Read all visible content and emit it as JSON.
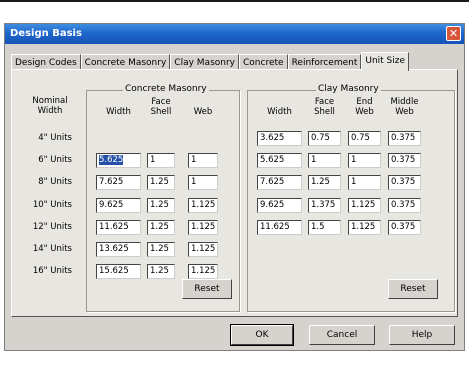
{
  "window": {
    "title": "Design Basis"
  },
  "tabs": [
    {
      "label": "Design Codes",
      "active": false
    },
    {
      "label": "Concrete Masonry",
      "active": false
    },
    {
      "label": "Clay Masonry",
      "active": false
    },
    {
      "label": "Concrete",
      "active": false
    },
    {
      "label": "Reinforcement",
      "active": false
    },
    {
      "label": "Unit Size",
      "active": true
    }
  ],
  "row_header": "Nominal\nWidth",
  "rows": [
    "4\" Units",
    "6\" Units",
    "8\" Units",
    "10\" Units",
    "12\" Units",
    "14\" Units",
    "16\" Units"
  ],
  "concrete": {
    "title": "Concrete Masonry",
    "headers": [
      "Width",
      "Face\nShell",
      "Web"
    ],
    "values": [
      null,
      [
        "5.625",
        "1",
        "1"
      ],
      [
        "7.625",
        "1.25",
        "1"
      ],
      [
        "9.625",
        "1.25",
        "1.125"
      ],
      [
        "11.625",
        "1.25",
        "1.125"
      ],
      [
        "13.625",
        "1.25",
        "1.125"
      ],
      [
        "15.625",
        "1.25",
        "1.125"
      ]
    ],
    "reset_label": "Reset"
  },
  "clay": {
    "title": "Clay Masonry",
    "headers": [
      "Width",
      "Face\nShell",
      "End\nWeb",
      "Middle\nWeb"
    ],
    "values": [
      [
        "3.625",
        "0.75",
        "0.75",
        "0.375"
      ],
      [
        "5.625",
        "1",
        "1",
        "0.375"
      ],
      [
        "7.625",
        "1.25",
        "1",
        "0.375"
      ],
      [
        "9.625",
        "1.375",
        "1.125",
        "0.375"
      ],
      [
        "11.625",
        "1.5",
        "1.125",
        "0.375"
      ],
      null,
      null
    ],
    "reset_label": "Reset"
  },
  "buttons": {
    "ok": "OK",
    "cancel": "Cancel",
    "help": "Help"
  },
  "colors": {
    "title_bar": "#1f66cc",
    "close": "#d9553a",
    "selection": "#2450a8"
  }
}
